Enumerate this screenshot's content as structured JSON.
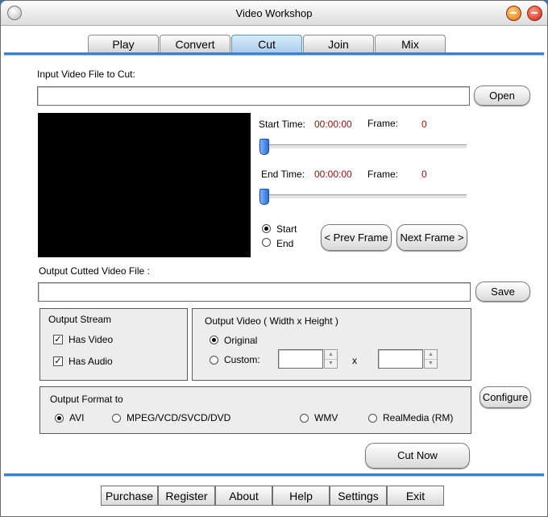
{
  "window": {
    "title": "Video Workshop"
  },
  "tabs": [
    {
      "label": "Play"
    },
    {
      "label": "Convert"
    },
    {
      "label": "Cut",
      "active": true
    },
    {
      "label": "Join"
    },
    {
      "label": "Mix"
    }
  ],
  "input": {
    "label": "Input Video File to Cut:",
    "value": "",
    "open_label": "Open"
  },
  "start": {
    "label": "Start Time:",
    "time": "00:00:00",
    "frame_label": "Frame:",
    "frame": "0",
    "slider_fraction": 0
  },
  "end": {
    "label": "End Time:",
    "time": "00:00:00",
    "frame_label": "Frame:",
    "frame": "0",
    "slider_fraction": 0
  },
  "position_radio": {
    "start_label": "Start",
    "end_label": "End",
    "selected": "Start"
  },
  "frame_nav": {
    "prev_label": "< Prev Frame",
    "next_label": "Next Frame >"
  },
  "output": {
    "label": "Output Cutted Video File :",
    "value": "",
    "save_label": "Save"
  },
  "output_stream": {
    "title": "Output Stream",
    "has_video_label": "Has Video",
    "has_video": true,
    "has_audio_label": "Has Audio",
    "has_audio": true
  },
  "output_video": {
    "title": "Output Video ( Width x Height )",
    "original_label": "Original",
    "custom_label": "Custom:",
    "selected": "Original",
    "width": "",
    "height": "",
    "x_label": "x"
  },
  "output_format": {
    "title": "Output Format to",
    "options": [
      "AVI",
      "MPEG/VCD/SVCD/DVD",
      "WMV",
      "RealMedia (RM)"
    ],
    "selected": "AVI"
  },
  "configure_label": "Configure",
  "cut_now_label": "Cut Now",
  "bottom_menu": [
    "Purchase",
    "Register",
    "About",
    "Help",
    "Settings",
    "Exit"
  ],
  "colors": {
    "accent_blue": "#3b7fd0",
    "time_red": "#8b1010",
    "active_tab": "#a9cdee"
  }
}
